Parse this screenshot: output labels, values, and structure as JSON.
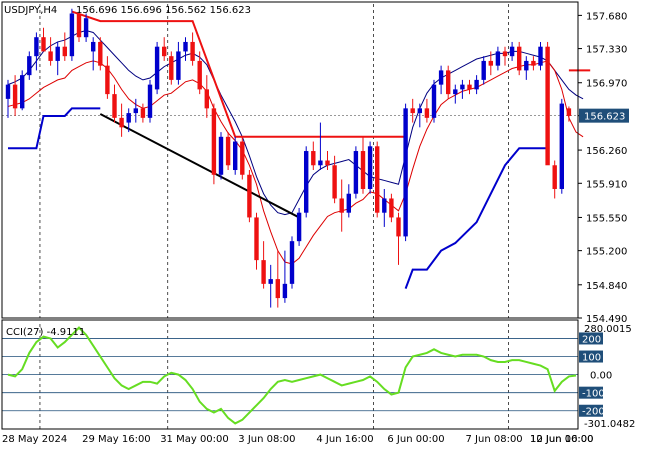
{
  "header": {
    "symbol": "USDJPY,H4",
    "ohlc": "156.696 156.696 156.562 156.623"
  },
  "cci_panel": {
    "label": "CCI(27) -4.9111",
    "max_label": "280.0015",
    "min_label": "-301.0482",
    "levels": [
      "200",
      "100",
      "0.00",
      "-100",
      "-200"
    ]
  },
  "colors": {
    "bull_candle": "#0000cc",
    "bear_candle": "#ee1111",
    "upper_trail": "#ee1111",
    "lower_trail": "#0000cc",
    "ma_fast": "#dd0000",
    "ma_slow": "#000080",
    "trendline": "#000000",
    "cci_line": "#66dd22",
    "level_line": "#1f4e79",
    "price_badge": "#1f4e79"
  },
  "chart_data": [
    {
      "type": "candlestick",
      "title": "USDJPY,H4",
      "ylim": [
        154.49,
        157.8
      ],
      "y_ticks": [
        "157.680",
        "157.330",
        "156.970",
        "156.623",
        "156.260",
        "155.910",
        "155.550",
        "155.200",
        "154.840",
        "154.490"
      ],
      "current_price": 156.623,
      "x_labels": [
        "28 May 2024",
        "29 May 16:00",
        "31 May 00:00",
        "3 Jun 08:00",
        "4 Jun 16:00",
        "6 Jun 00:00",
        "7 Jun 08:00",
        "10 Jun 16:00",
        "12 Jun 00:00"
      ],
      "candles": [
        {
          "o": 156.8,
          "h": 157.0,
          "l": 156.6,
          "c": 156.95
        },
        {
          "o": 156.95,
          "h": 157.05,
          "l": 156.62,
          "c": 156.7
        },
        {
          "o": 156.7,
          "h": 157.1,
          "l": 156.68,
          "c": 157.05
        },
        {
          "o": 157.05,
          "h": 157.3,
          "l": 157.0,
          "c": 157.25
        },
        {
          "o": 157.25,
          "h": 157.5,
          "l": 157.1,
          "c": 157.45
        },
        {
          "o": 157.45,
          "h": 157.55,
          "l": 157.3,
          "c": 157.3
        },
        {
          "o": 157.3,
          "h": 157.45,
          "l": 157.15,
          "c": 157.2
        },
        {
          "o": 157.2,
          "h": 157.4,
          "l": 157.05,
          "c": 157.35
        },
        {
          "o": 157.35,
          "h": 157.5,
          "l": 157.2,
          "c": 157.25
        },
        {
          "o": 157.25,
          "h": 157.75,
          "l": 157.2,
          "c": 157.7
        },
        {
          "o": 157.7,
          "h": 157.72,
          "l": 157.4,
          "c": 157.45
        },
        {
          "o": 157.45,
          "h": 157.7,
          "l": 157.4,
          "c": 157.65
        },
        {
          "o": 157.3,
          "h": 157.45,
          "l": 157.1,
          "c": 157.4
        },
        {
          "o": 157.4,
          "h": 157.45,
          "l": 157.1,
          "c": 157.15
        },
        {
          "o": 157.15,
          "h": 157.25,
          "l": 156.8,
          "c": 156.85
        },
        {
          "o": 156.85,
          "h": 156.95,
          "l": 156.55,
          "c": 156.6
        },
        {
          "o": 156.6,
          "h": 156.75,
          "l": 156.4,
          "c": 156.5
        },
        {
          "o": 156.55,
          "h": 156.7,
          "l": 156.45,
          "c": 156.65
        },
        {
          "o": 156.65,
          "h": 156.8,
          "l": 156.55,
          "c": 156.7
        },
        {
          "o": 156.7,
          "h": 156.75,
          "l": 156.55,
          "c": 156.6
        },
        {
          "o": 156.6,
          "h": 157.0,
          "l": 156.55,
          "c": 156.95
        },
        {
          "o": 156.9,
          "h": 157.4,
          "l": 156.85,
          "c": 157.35
        },
        {
          "o": 157.35,
          "h": 157.45,
          "l": 157.2,
          "c": 157.25
        },
        {
          "o": 157.25,
          "h": 157.3,
          "l": 156.95,
          "c": 157.0
        },
        {
          "o": 157.0,
          "h": 157.4,
          "l": 156.95,
          "c": 157.3
        },
        {
          "o": 157.3,
          "h": 157.45,
          "l": 157.2,
          "c": 157.4
        },
        {
          "o": 157.4,
          "h": 157.5,
          "l": 157.15,
          "c": 157.2
        },
        {
          "o": 157.2,
          "h": 157.3,
          "l": 156.85,
          "c": 156.9
        },
        {
          "o": 156.9,
          "h": 157.05,
          "l": 156.6,
          "c": 156.7
        },
        {
          "o": 156.7,
          "h": 156.75,
          "l": 155.9,
          "c": 156.0
        },
        {
          "o": 156.0,
          "h": 156.45,
          "l": 155.95,
          "c": 156.4
        },
        {
          "o": 156.4,
          "h": 156.45,
          "l": 156.05,
          "c": 156.1
        },
        {
          "o": 156.05,
          "h": 156.4,
          "l": 156.0,
          "c": 156.35
        },
        {
          "o": 156.35,
          "h": 156.4,
          "l": 155.95,
          "c": 156.0
        },
        {
          "o": 156.0,
          "h": 156.05,
          "l": 155.5,
          "c": 155.55
        },
        {
          "o": 155.55,
          "h": 155.6,
          "l": 155.0,
          "c": 155.1
        },
        {
          "o": 155.1,
          "h": 155.3,
          "l": 154.8,
          "c": 154.85
        },
        {
          "o": 154.85,
          "h": 155.05,
          "l": 154.6,
          "c": 154.9
        },
        {
          "o": 154.9,
          "h": 155.2,
          "l": 154.6,
          "c": 154.7
        },
        {
          "o": 154.7,
          "h": 155.2,
          "l": 154.65,
          "c": 154.85
        },
        {
          "o": 154.85,
          "h": 155.35,
          "l": 154.8,
          "c": 155.3
        },
        {
          "o": 155.3,
          "h": 155.65,
          "l": 155.25,
          "c": 155.6
        },
        {
          "o": 155.6,
          "h": 156.3,
          "l": 155.55,
          "c": 156.25
        },
        {
          "o": 156.25,
          "h": 156.35,
          "l": 156.05,
          "c": 156.1
        },
        {
          "o": 156.1,
          "h": 156.55,
          "l": 156.05,
          "c": 156.15
        },
        {
          "o": 156.15,
          "h": 156.25,
          "l": 156.05,
          "c": 156.1
        },
        {
          "o": 156.1,
          "h": 156.2,
          "l": 155.7,
          "c": 155.75
        },
        {
          "o": 155.75,
          "h": 155.95,
          "l": 155.4,
          "c": 155.6
        },
        {
          "o": 155.6,
          "h": 155.9,
          "l": 155.55,
          "c": 155.8
        },
        {
          "o": 155.8,
          "h": 156.3,
          "l": 155.75,
          "c": 156.25
        },
        {
          "o": 156.25,
          "h": 156.4,
          "l": 155.8,
          "c": 155.85
        },
        {
          "o": 155.85,
          "h": 156.35,
          "l": 155.8,
          "c": 156.3
        },
        {
          "o": 156.3,
          "h": 156.35,
          "l": 155.55,
          "c": 155.6
        },
        {
          "o": 155.6,
          "h": 155.85,
          "l": 155.45,
          "c": 155.75
        },
        {
          "o": 155.75,
          "h": 155.8,
          "l": 155.5,
          "c": 155.55
        },
        {
          "o": 155.55,
          "h": 155.6,
          "l": 155.05,
          "c": 155.35
        },
        {
          "o": 155.35,
          "h": 156.75,
          "l": 155.3,
          "c": 156.7
        },
        {
          "o": 156.7,
          "h": 156.8,
          "l": 156.55,
          "c": 156.65
        },
        {
          "o": 156.65,
          "h": 156.75,
          "l": 156.5,
          "c": 156.7
        },
        {
          "o": 156.7,
          "h": 156.8,
          "l": 156.55,
          "c": 156.6
        },
        {
          "o": 156.6,
          "h": 157.0,
          "l": 156.55,
          "c": 156.95
        },
        {
          "o": 156.95,
          "h": 157.15,
          "l": 156.85,
          "c": 157.1
        },
        {
          "o": 157.1,
          "h": 157.15,
          "l": 156.8,
          "c": 156.85
        },
        {
          "o": 156.85,
          "h": 156.95,
          "l": 156.75,
          "c": 156.9
        },
        {
          "o": 156.9,
          "h": 157.0,
          "l": 156.8,
          "c": 156.95
        },
        {
          "o": 156.95,
          "h": 157.0,
          "l": 156.85,
          "c": 156.9
        },
        {
          "o": 156.9,
          "h": 157.05,
          "l": 156.85,
          "c": 157.0
        },
        {
          "o": 157.0,
          "h": 157.25,
          "l": 156.95,
          "c": 157.2
        },
        {
          "o": 157.2,
          "h": 157.3,
          "l": 157.05,
          "c": 157.15
        },
        {
          "o": 157.15,
          "h": 157.35,
          "l": 157.1,
          "c": 157.3
        },
        {
          "o": 157.3,
          "h": 157.35,
          "l": 157.15,
          "c": 157.25
        },
        {
          "o": 157.25,
          "h": 157.4,
          "l": 157.2,
          "c": 157.35
        },
        {
          "o": 157.35,
          "h": 157.4,
          "l": 157.05,
          "c": 157.1
        },
        {
          "o": 157.1,
          "h": 157.25,
          "l": 157.0,
          "c": 157.2
        },
        {
          "o": 157.2,
          "h": 157.25,
          "l": 157.1,
          "c": 157.15
        },
        {
          "o": 157.15,
          "h": 157.4,
          "l": 157.1,
          "c": 157.35
        },
        {
          "o": 157.35,
          "h": 157.4,
          "l": 156.9,
          "c": 156.1
        },
        {
          "o": 156.1,
          "h": 156.15,
          "l": 155.75,
          "c": 155.85
        },
        {
          "o": 155.85,
          "h": 156.8,
          "l": 155.8,
          "c": 156.75
        },
        {
          "o": 156.7,
          "h": 156.72,
          "l": 156.56,
          "c": 156.62
        }
      ],
      "upper_trail": [
        [
          9,
          157.72
        ],
        [
          13,
          157.62
        ],
        [
          26,
          157.62
        ],
        [
          32,
          156.4
        ],
        [
          44,
          156.4
        ],
        [
          45,
          156.4
        ],
        [
          46,
          156.4
        ],
        [
          47,
          156.4
        ],
        [
          48,
          156.4
        ],
        [
          49,
          156.4
        ],
        [
          50,
          156.4
        ],
        [
          51,
          156.4
        ],
        [
          52,
          156.4
        ],
        [
          53,
          156.4
        ],
        [
          54,
          156.4
        ],
        [
          55,
          156.4
        ],
        [
          56,
          156.4
        ]
      ],
      "upper_trail_recent": [
        [
          79,
          157.1
        ],
        [
          82,
          157.1
        ]
      ],
      "lower_trail": [
        [
          0,
          156.28
        ],
        [
          4,
          156.28
        ],
        [
          5,
          156.62
        ],
        [
          8,
          156.62
        ],
        [
          9,
          156.7
        ],
        [
          13,
          156.7
        ]
      ],
      "lower_trail_recent": [
        [
          56,
          154.8
        ],
        [
          57,
          155.0
        ],
        [
          59,
          155.0
        ],
        [
          61,
          155.2
        ],
        [
          63,
          155.28
        ],
        [
          66,
          155.5
        ],
        [
          68,
          155.8
        ],
        [
          70,
          156.1
        ],
        [
          72,
          156.28
        ],
        [
          76,
          156.28
        ]
      ],
      "trendline": [
        [
          13,
          156.64
        ],
        [
          41,
          155.55
        ]
      ],
      "ma_fast": [
        156.72,
        156.74,
        156.76,
        156.8,
        156.86,
        156.92,
        156.96,
        157.0,
        157.02,
        157.1,
        157.14,
        157.18,
        157.2,
        157.18,
        157.12,
        157.02,
        156.9,
        156.8,
        156.74,
        156.7,
        156.72,
        156.78,
        156.84,
        156.86,
        156.92,
        156.98,
        157.0,
        156.96,
        156.88,
        156.7,
        156.56,
        156.44,
        156.36,
        156.26,
        156.1,
        155.9,
        155.62,
        155.4,
        155.2,
        155.08,
        155.06,
        155.12,
        155.24,
        155.36,
        155.46,
        155.56,
        155.6,
        155.62,
        155.64,
        155.7,
        155.74,
        155.82,
        155.8,
        155.74,
        155.68,
        155.62,
        155.8,
        156.06,
        156.3,
        156.48,
        156.62,
        156.74,
        156.8,
        156.84,
        156.88,
        156.9,
        156.92,
        156.96,
        157.0,
        157.04,
        157.08,
        157.12,
        157.14,
        157.16,
        157.16,
        157.18,
        157.2,
        157.1,
        156.9,
        156.6,
        156.45,
        156.4
      ],
      "ma_slow": [
        156.95,
        156.98,
        157.02,
        157.1,
        157.2,
        157.3,
        157.36,
        157.4,
        157.42,
        157.46,
        157.5,
        157.52,
        157.5,
        157.42,
        157.34,
        157.26,
        157.18,
        157.1,
        157.04,
        157.0,
        157.02,
        157.08,
        157.14,
        157.18,
        157.22,
        157.26,
        157.28,
        157.24,
        157.16,
        157.0,
        156.84,
        156.7,
        156.56,
        156.4,
        156.2,
        155.98,
        155.8,
        155.68,
        155.6,
        155.58,
        155.6,
        155.74,
        155.88,
        156.0,
        156.06,
        156.1,
        156.12,
        156.14,
        156.16,
        156.1,
        156.04,
        155.98,
        155.96,
        155.94,
        155.92,
        155.9,
        156.2,
        156.5,
        156.7,
        156.86,
        156.96,
        157.02,
        157.06,
        157.1,
        157.14,
        157.18,
        157.22,
        157.24,
        157.26,
        157.28,
        157.28,
        157.3,
        157.3,
        157.28,
        157.26,
        157.24,
        157.2,
        157.1,
        157.0,
        156.9,
        156.84,
        156.8
      ]
    },
    {
      "type": "line",
      "title": "CCI(27) -4.9111",
      "ylim": [
        -301.0482,
        280.0015
      ],
      "levels": [
        200,
        100,
        0,
        -100,
        -200
      ],
      "values": [
        0,
        -10,
        30,
        120,
        180,
        210,
        200,
        150,
        180,
        220,
        260,
        220,
        160,
        100,
        40,
        -20,
        -60,
        -80,
        -60,
        -40,
        -40,
        -50,
        -10,
        10,
        0,
        -30,
        -80,
        -150,
        -190,
        -210,
        -190,
        -240,
        -270,
        -250,
        -210,
        -170,
        -130,
        -80,
        -40,
        -30,
        -40,
        -30,
        -20,
        -10,
        0,
        -20,
        -40,
        -60,
        -50,
        -40,
        -30,
        -10,
        -40,
        -80,
        -110,
        -100,
        40,
        100,
        110,
        120,
        140,
        120,
        110,
        100,
        110,
        110,
        110,
        100,
        80,
        70,
        70,
        80,
        80,
        70,
        60,
        50,
        30,
        -90,
        -40,
        -10,
        -4.9111
      ]
    }
  ]
}
